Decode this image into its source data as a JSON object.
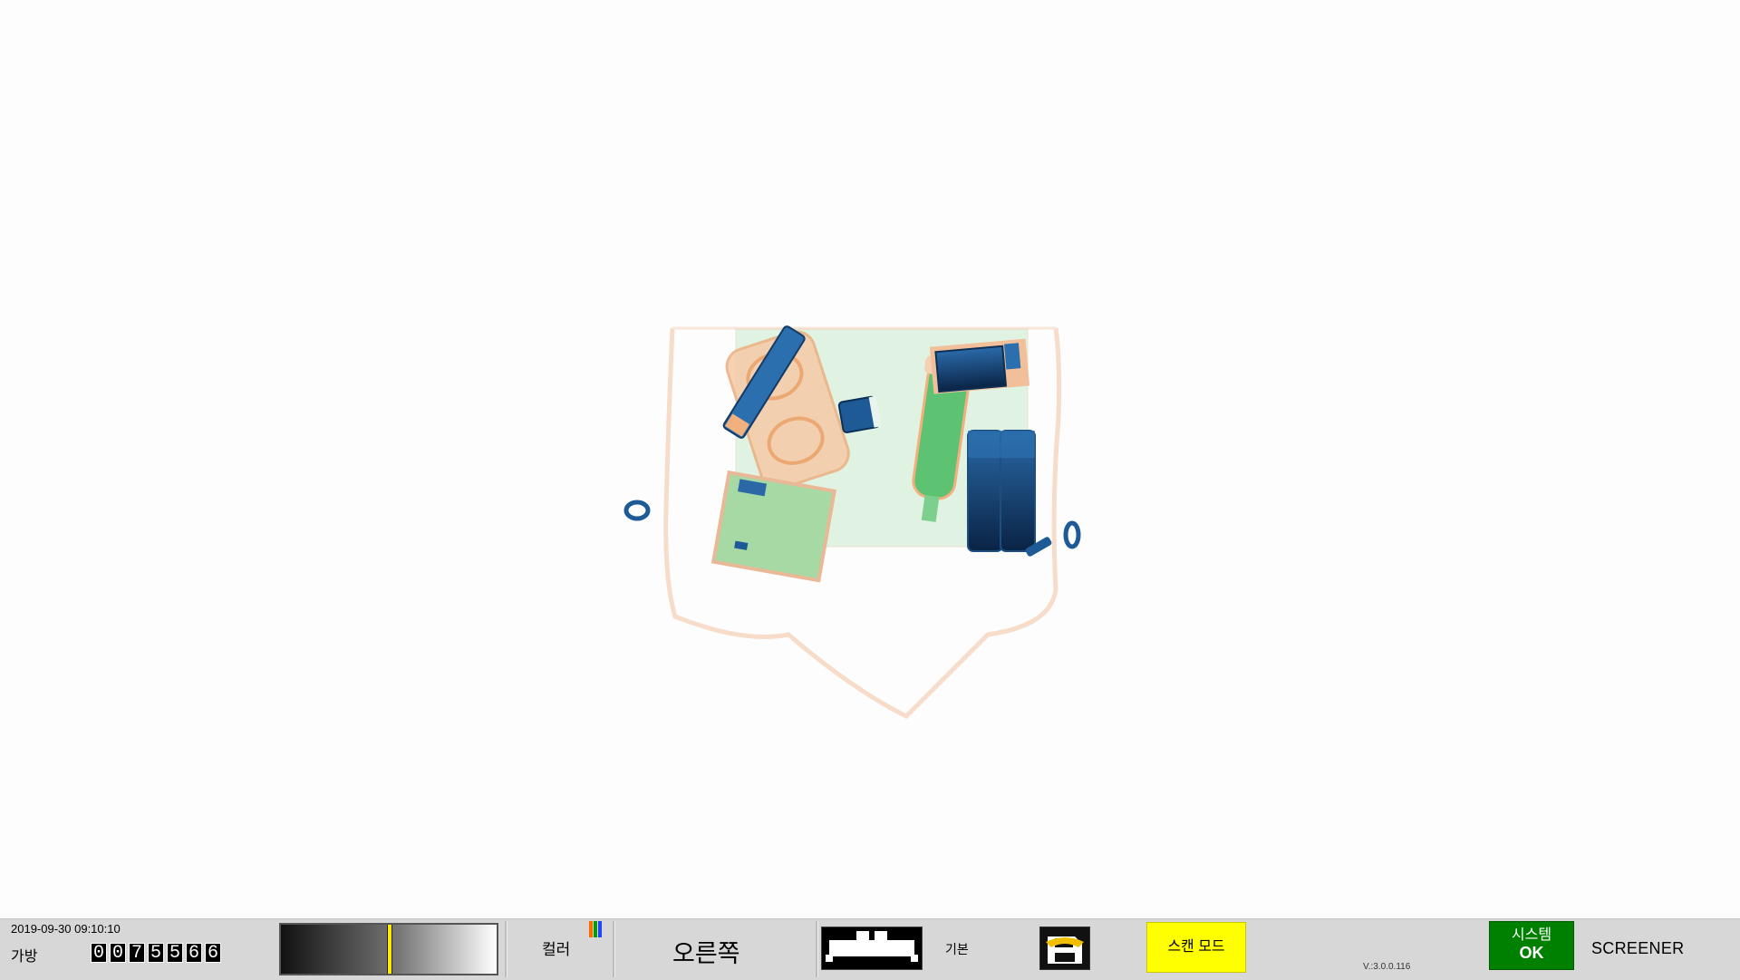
{
  "statusbar": {
    "datetime": "2019-09-30 09:10:10",
    "bag_label": "가방",
    "bag_counter": [
      "0",
      "0",
      "7",
      "5",
      "5",
      "6",
      "6"
    ],
    "color_label": "컬러",
    "direction": "오른쪽",
    "basic_label": "기본",
    "scan_mode": "스캔 모드",
    "version": "V.:3.0.0.116",
    "system_line1": "시스템",
    "system_line2": "OK",
    "screener": "SCREENER"
  },
  "colors": {
    "scan_mode_bg": "#ffff00",
    "system_ok_bg": "#008000",
    "organic": "#f2b07e",
    "inorganic": "#7fd08e",
    "metal": "#2c6fae"
  },
  "icons": {
    "color_palette": "color-bars-icon",
    "scanner": "conveyor-scanner-icon",
    "save": "floppy-save-icon"
  }
}
